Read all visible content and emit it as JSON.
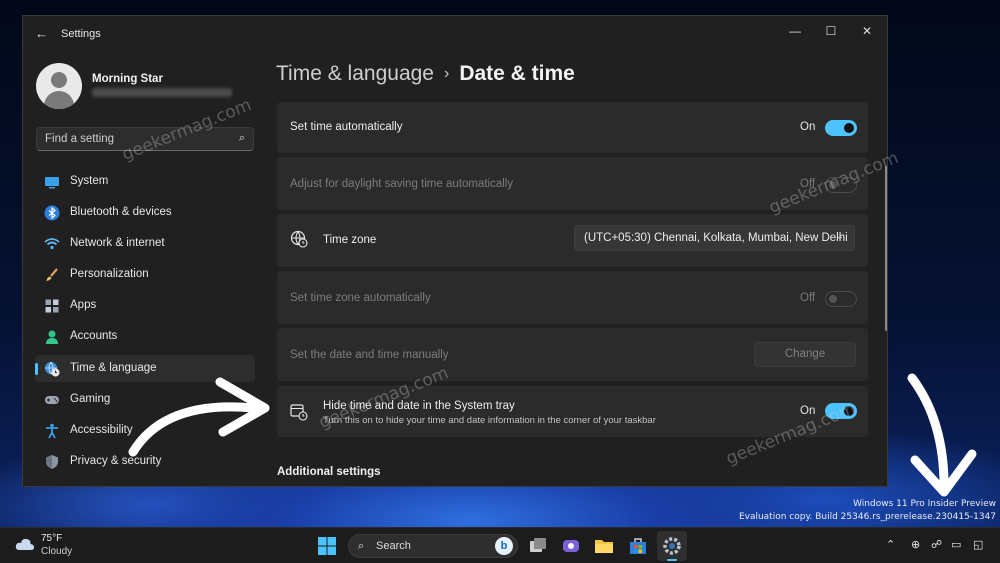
{
  "window": {
    "title": "Settings"
  },
  "user": {
    "name": "Morning Star"
  },
  "search": {
    "placeholder": "Find a setting"
  },
  "nav": [
    {
      "label": "System",
      "icon": "monitor-icon",
      "active": false
    },
    {
      "label": "Bluetooth & devices",
      "icon": "bluetooth-icon",
      "active": false
    },
    {
      "label": "Network & internet",
      "icon": "wifi-icon",
      "active": false
    },
    {
      "label": "Personalization",
      "icon": "brush-icon",
      "active": false
    },
    {
      "label": "Apps",
      "icon": "apps-icon",
      "active": false
    },
    {
      "label": "Accounts",
      "icon": "person-icon",
      "active": false
    },
    {
      "label": "Time & language",
      "icon": "globe-clock-icon",
      "active": true
    },
    {
      "label": "Gaming",
      "icon": "gamepad-icon",
      "active": false
    },
    {
      "label": "Accessibility",
      "icon": "accessibility-icon",
      "active": false
    },
    {
      "label": "Privacy & security",
      "icon": "shield-icon",
      "active": false
    }
  ],
  "breadcrumb": {
    "parent": "Time & language",
    "separator": "›",
    "current": "Date & time"
  },
  "settings": {
    "set_time_auto": {
      "label": "Set time automatically",
      "state": "On"
    },
    "daylight": {
      "label": "Adjust for daylight saving time automatically",
      "state": "Off"
    },
    "time_zone": {
      "label": "Time zone",
      "value": "(UTC+05:30) Chennai, Kolkata, Mumbai, New Delhi"
    },
    "tz_auto": {
      "label": "Set time zone automatically",
      "state": "Off"
    },
    "manual": {
      "label": "Set the date and time manually",
      "button": "Change"
    },
    "hide_tray": {
      "label": "Hide time and date in the System tray",
      "description": "Turn this on to hide your time and date information in the corner of your taskbar",
      "state": "On"
    }
  },
  "section": {
    "additional": "Additional settings"
  },
  "watermark": {
    "brand": "geekermag.com",
    "os": "Windows 11 Pro Insider Preview",
    "build": "Evaluation copy. Build 25346.rs_prerelease.230415-1347"
  },
  "taskbar": {
    "temp": "75°F",
    "condition": "Cloudy",
    "search": "Search"
  },
  "colors": {
    "accent": "#4cc2ff",
    "window_bg": "#202020",
    "card_bg": "#2b2b2b"
  }
}
